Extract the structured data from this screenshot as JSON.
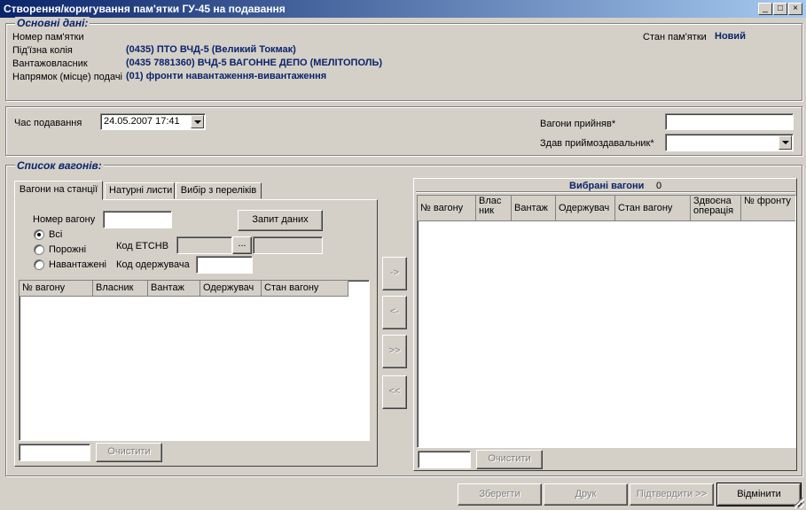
{
  "window": {
    "title": "Створення/коригування пам'ятки ГУ-45 на подавання",
    "minimize_icon": "minimize-icon",
    "maximize_icon": "maximize-icon",
    "close_icon": "close-icon"
  },
  "basic": {
    "legend": "Основні дані:",
    "memo_number_label": "Номер пам'ятки",
    "memo_number_value": "",
    "track_label": "Під'їзна колія",
    "track_value": "(0435) ПТО ВЧД-5 (Великий Токмак)",
    "owner_label": "Вантажовласник",
    "owner_value": "(0435 7881360) ВЧД-5 ВАГОННЕ ДЕПО (МЕЛІТОПОЛЬ)",
    "direction_label": "Напрямок (місце) подачі",
    "direction_value": "(01) фронти навантаження-вивантаження",
    "status_label": "Стан пам'ятки",
    "status_value": "Новий"
  },
  "delivery": {
    "time_label": "Час подавання",
    "time_value": "24.05.2007 17:41",
    "accepted_label": "Вагони прийняв*",
    "accepted_value": "",
    "handed_label": "Здав приймоздавальник*",
    "handed_value": ""
  },
  "wagons": {
    "legend": "Список вагонів:",
    "tabs": [
      "Вагони на станції",
      "Натурні листи",
      "Вибір з переліків"
    ],
    "wagon_number_label": "Номер вагону",
    "wagon_number_value": "",
    "request_button": "Запит даних",
    "radio_all": "Всі",
    "radio_empty": "Порожні",
    "radio_loaded": "Навантажені",
    "etsnv_label": "Код ЕТСНВ",
    "etsnv_value": "",
    "browse_button": "...",
    "receiver_label": "Код одержувача",
    "receiver_value": "",
    "left_columns": [
      "№ вагону",
      "Власник",
      "Вантаж",
      "Одержувач",
      "Стан вагону"
    ],
    "left_filter_value": "",
    "clear_button": "Очистити"
  },
  "transfer": {
    "move_right": "->",
    "move_left": "<-",
    "move_all_right": ">>",
    "move_all_left": "<<"
  },
  "selected": {
    "title": "Вибрані вагони",
    "count": "0",
    "columns": [
      "№ вагону",
      "Влас ник",
      "Вантаж",
      "Одержувач",
      "Стан вагону",
      "Здвоєна операція",
      "№ фронту"
    ],
    "filter_value": "",
    "clear_button": "Очистити"
  },
  "footer": {
    "save": "Зберегти",
    "print": "Друк",
    "confirm": "Підтвердити >>",
    "cancel": "Відмінити"
  }
}
